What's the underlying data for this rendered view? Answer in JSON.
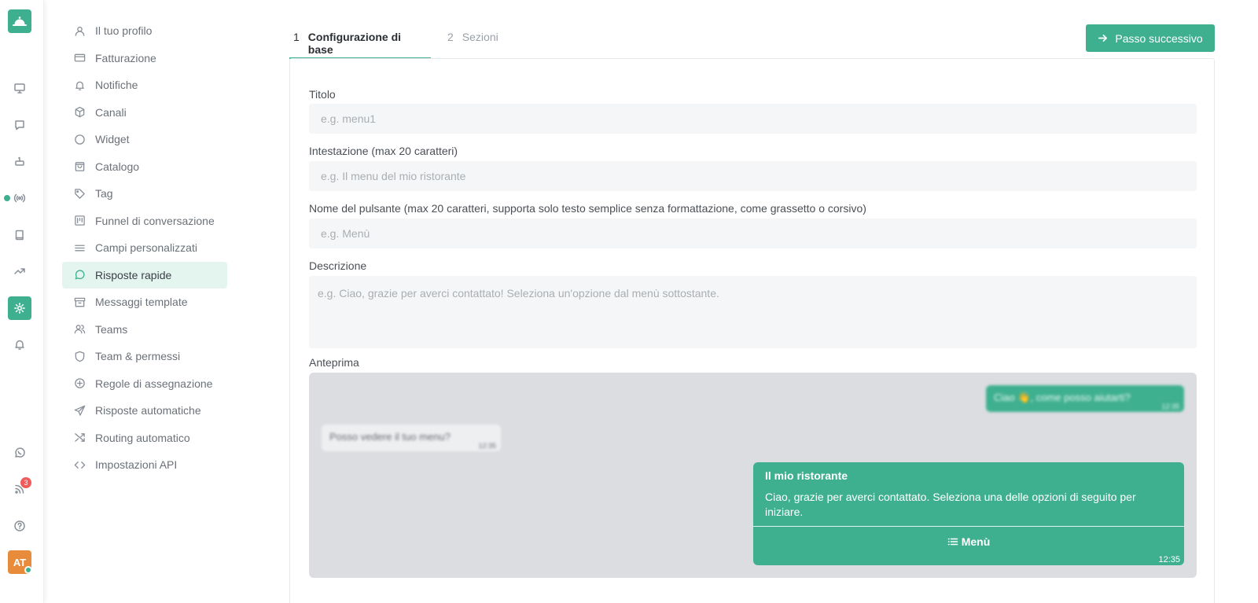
{
  "rail": {
    "logo": "bell-service-icon",
    "icons": [
      "monitor-icon",
      "chat-icon",
      "bot-icon",
      "broadcast-icon",
      "book-icon",
      "trending-icon",
      "settings-icon",
      "bell-icon",
      "whatsapp-icon",
      "rss-icon",
      "help-icon"
    ],
    "active_icon": "settings-icon",
    "rss_badge": "3",
    "avatar_initials": "AT",
    "accent_color": "#3fb08f"
  },
  "menu": {
    "items": [
      {
        "label": "Il tuo profilo",
        "icon": "user-icon"
      },
      {
        "label": "Fatturazione",
        "icon": "credit-card-icon"
      },
      {
        "label": "Notifiche",
        "icon": "bell-icon"
      },
      {
        "label": "Canali",
        "icon": "box-icon"
      },
      {
        "label": "Widget",
        "icon": "circle-icon"
      },
      {
        "label": "Catalogo",
        "icon": "shopping-bag-icon"
      },
      {
        "label": "Tag",
        "icon": "tag-icon"
      },
      {
        "label": "Funnel di conversazione",
        "icon": "kanban-icon"
      },
      {
        "label": "Campi personalizzati",
        "icon": "lines-icon"
      },
      {
        "label": "Risposte rapide",
        "icon": "message-circle-icon"
      },
      {
        "label": "Messaggi template",
        "icon": "archive-icon"
      },
      {
        "label": "Teams",
        "icon": "users-icon"
      },
      {
        "label": "Team & permessi",
        "icon": "shield-icon"
      },
      {
        "label": "Regole di assegnazione",
        "icon": "plus-circle-icon"
      },
      {
        "label": "Risposte automatiche",
        "icon": "send-icon"
      },
      {
        "label": "Routing automatico",
        "icon": "shuffle-icon"
      },
      {
        "label": "Impostazioni API",
        "icon": "code-icon"
      }
    ],
    "active_label": "Risposte rapide"
  },
  "tabs": [
    {
      "num": "1",
      "label": "Configurazione di base",
      "active": true
    },
    {
      "num": "2",
      "label": "Sezioni",
      "active": false
    }
  ],
  "next_button": "Passo successivo",
  "form": {
    "title_label": "Titolo",
    "title_placeholder": "e.g. menu1",
    "header_label": "Intestazione (max 20 caratteri)",
    "header_placeholder": "e.g. Il menu del mio ristorante",
    "button_label": "Nome del pulsante (max 20 caratteri, supporta solo testo semplice senza formattazione, come grassetto o corsivo)",
    "button_placeholder": "e.g. Menù",
    "description_label": "Descrizione",
    "description_placeholder": "e.g. Ciao, grazie per averci contattato! Seleziona un'opzione dal menù sottostante.",
    "preview_label": "Anteprima"
  },
  "preview": {
    "outgoing_text": "Ciao 👋, come posso aiutarti?",
    "outgoing_time": "12:35",
    "incoming_text": "Posso vedere il tuo menu?",
    "incoming_time": "12:35",
    "card_title": "Il mio ristorante",
    "card_text": "Ciao, grazie per averci contattato. Seleziona una delle opzioni di seguito per iniziare.",
    "card_button": "Menù",
    "card_time": "12:35"
  }
}
